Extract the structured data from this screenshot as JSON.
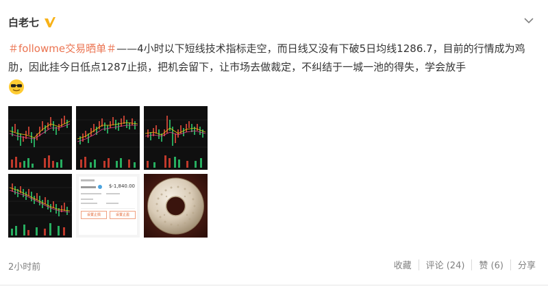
{
  "post": {
    "author": "白老七",
    "verified_icon": "verified-v-icon",
    "topic": "＃followme交易晒单＃",
    "text": "——4小时以下短线技术指标走空，而日线又没有下破5日均线1286.7，目前的行情成为鸡肋，因此挂今日低点1287止损，把机会留下，让市场去做裁定，不纠结于一城一池的得失，学会放手",
    "emoji": "sunglasses-face-icon"
  },
  "images": {
    "phone": {
      "balance": "$-1,840.00",
      "btn_left": "设置止损",
      "btn_right": "设置止盈"
    }
  },
  "footer": {
    "time": "2小时前",
    "favorite": "收藏",
    "comment": "评论 (24)",
    "like": "赞 (6)",
    "share": "分享"
  },
  "colors": {
    "topic": "#eb7350",
    "verified": "#f7b219",
    "muted": "#808080"
  }
}
